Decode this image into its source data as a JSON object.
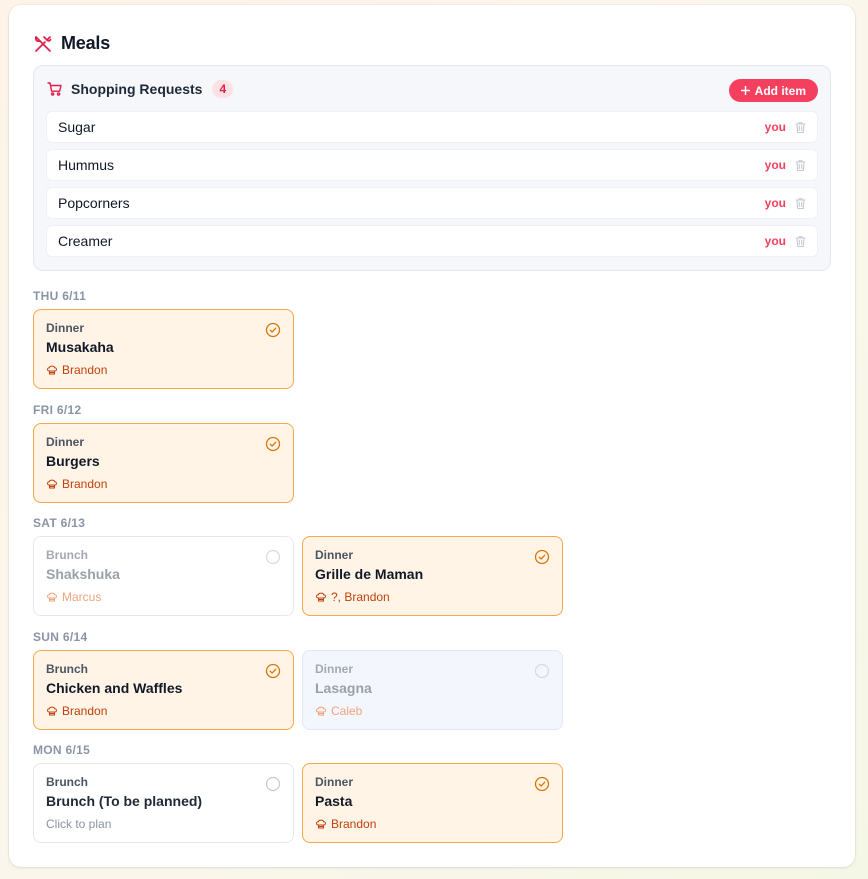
{
  "header": {
    "title": "Meals",
    "icon": "utensils-icon"
  },
  "shopping": {
    "title": "Shopping Requests",
    "count": "4",
    "add_label": "Add item",
    "items": [
      {
        "name": "Sugar",
        "owner": "you"
      },
      {
        "name": "Hummus",
        "owner": "you"
      },
      {
        "name": "Popcorners",
        "owner": "you"
      },
      {
        "name": "Creamer",
        "owner": "you"
      }
    ]
  },
  "days": [
    {
      "label": "THU 6/11",
      "meals": [
        {
          "type": "Dinner",
          "name": "Musakaha",
          "cook": "Brandon",
          "state": "confirmed"
        }
      ]
    },
    {
      "label": "FRI 6/12",
      "meals": [
        {
          "type": "Dinner",
          "name": "Burgers",
          "cook": "Brandon",
          "state": "confirmed"
        }
      ]
    },
    {
      "label": "SAT 6/13",
      "meals": [
        {
          "type": "Brunch",
          "name": "Shakshuka",
          "cook": "Marcus",
          "state": "pending"
        },
        {
          "type": "Dinner",
          "name": "Grille de Maman",
          "cook": "?, Brandon",
          "state": "confirmed"
        }
      ]
    },
    {
      "label": "SUN 6/14",
      "meals": [
        {
          "type": "Brunch",
          "name": "Chicken and Waffles",
          "cook": "Brandon",
          "state": "confirmed"
        },
        {
          "type": "Dinner",
          "name": "Lasagna",
          "cook": "Caleb",
          "state": "pending-blue"
        }
      ]
    },
    {
      "label": "MON 6/15",
      "meals": [
        {
          "type": "Brunch",
          "name": "Brunch (To be planned)",
          "hint": "Click to plan",
          "state": "planner"
        },
        {
          "type": "Dinner",
          "name": "Pasta",
          "cook": "Brandon",
          "state": "confirmed"
        }
      ]
    }
  ],
  "colors": {
    "accent": "#f43f5e",
    "confirmed_bg": "#fff4e6",
    "confirmed_border": "#f5a94a",
    "cook_text": "#c2410c"
  }
}
